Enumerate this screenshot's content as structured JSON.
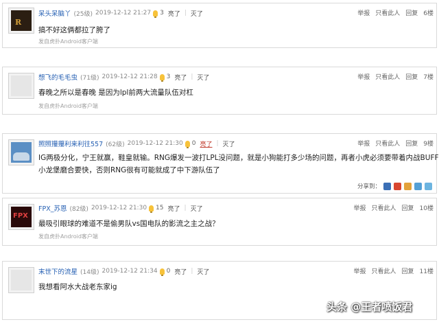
{
  "posts": [
    {
      "username": "呆头呆脑丫",
      "level": "(25级)",
      "time": "2019-12-12 21:27",
      "likes": "3",
      "like_label": "亮了",
      "extinguish_label": "灭了",
      "like_active": false,
      "content_lines": [
        "搞不好这俩都拉了胯了"
      ],
      "source": "发自虎扑Android客户端",
      "report": "举报",
      "only_this": "只看此人",
      "reply": "回复",
      "floor": "6楼",
      "avatar_color": "#3a2a1a"
    },
    {
      "username": "想飞的毛毛虫",
      "level": "(71级)",
      "time": "2019-12-12 21:28",
      "likes": "3",
      "like_label": "亮了",
      "extinguish_label": "灭了",
      "like_active": false,
      "content_lines": [
        "春晚之所以是春晚 是因为lpl前两大流量队伍对杠"
      ],
      "source": "发自虎扑Android客户端",
      "report": "举报",
      "only_this": "只看此人",
      "reply": "回复",
      "floor": "7楼",
      "avatar_color": "#e8e8e8"
    },
    {
      "username": "照照攥攥利来利往557",
      "level": "(62级)",
      "time": "2019-12-12 21:30",
      "likes": "0",
      "like_label": "亮了",
      "extinguish_label": "灭了",
      "like_active": true,
      "content_lines": [
        "IG两极分化，宁王就赢，鞋皇就输。RNG爆发一波打LPL没问题，就是小狗能打多少场的问题，再者小虎必须要带着内战BUFF，",
        "小龙堡磨合要快，否则RNG很有可能就成了中下游队伍了"
      ],
      "source": "",
      "share_label": "分享到：",
      "report": "举报",
      "only_this": "只看此人",
      "reply": "回复",
      "floor": "9楼",
      "avatar_color": "#4a7fb5"
    },
    {
      "username": "FPX_苏恩",
      "level": "(82级)",
      "time": "2019-12-12 21:30",
      "likes": "15",
      "like_label": "亮了",
      "extinguish_label": "灭了",
      "like_active": false,
      "content_lines": [
        "最吸引眼球的难道不是偷男队vs国电队的影流之主之战？"
      ],
      "source": "发自虎扑Android客户端",
      "report": "举报",
      "only_this": "只看此人",
      "reply": "回复",
      "floor": "10楼",
      "avatar_color": "#8b1a1a"
    },
    {
      "username": "末世下的流星",
      "level": "(14级)",
      "time": "2019-12-12 21:34",
      "likes": "0",
      "like_label": "亮了",
      "extinguish_label": "灭了",
      "like_active": false,
      "content_lines": [
        "我想看阿水大战老东家ig"
      ],
      "source": "",
      "report": "举报",
      "only_this": "只看此人",
      "reply": "回复",
      "floor": "11楼",
      "avatar_color": "#e8e8e8"
    }
  ],
  "share_colors": [
    "#3b6fb6",
    "#d9462f",
    "#e3a23a",
    "#54a0d6",
    "#6cb4e0"
  ],
  "watermark": "头条 @王者喷饭君"
}
